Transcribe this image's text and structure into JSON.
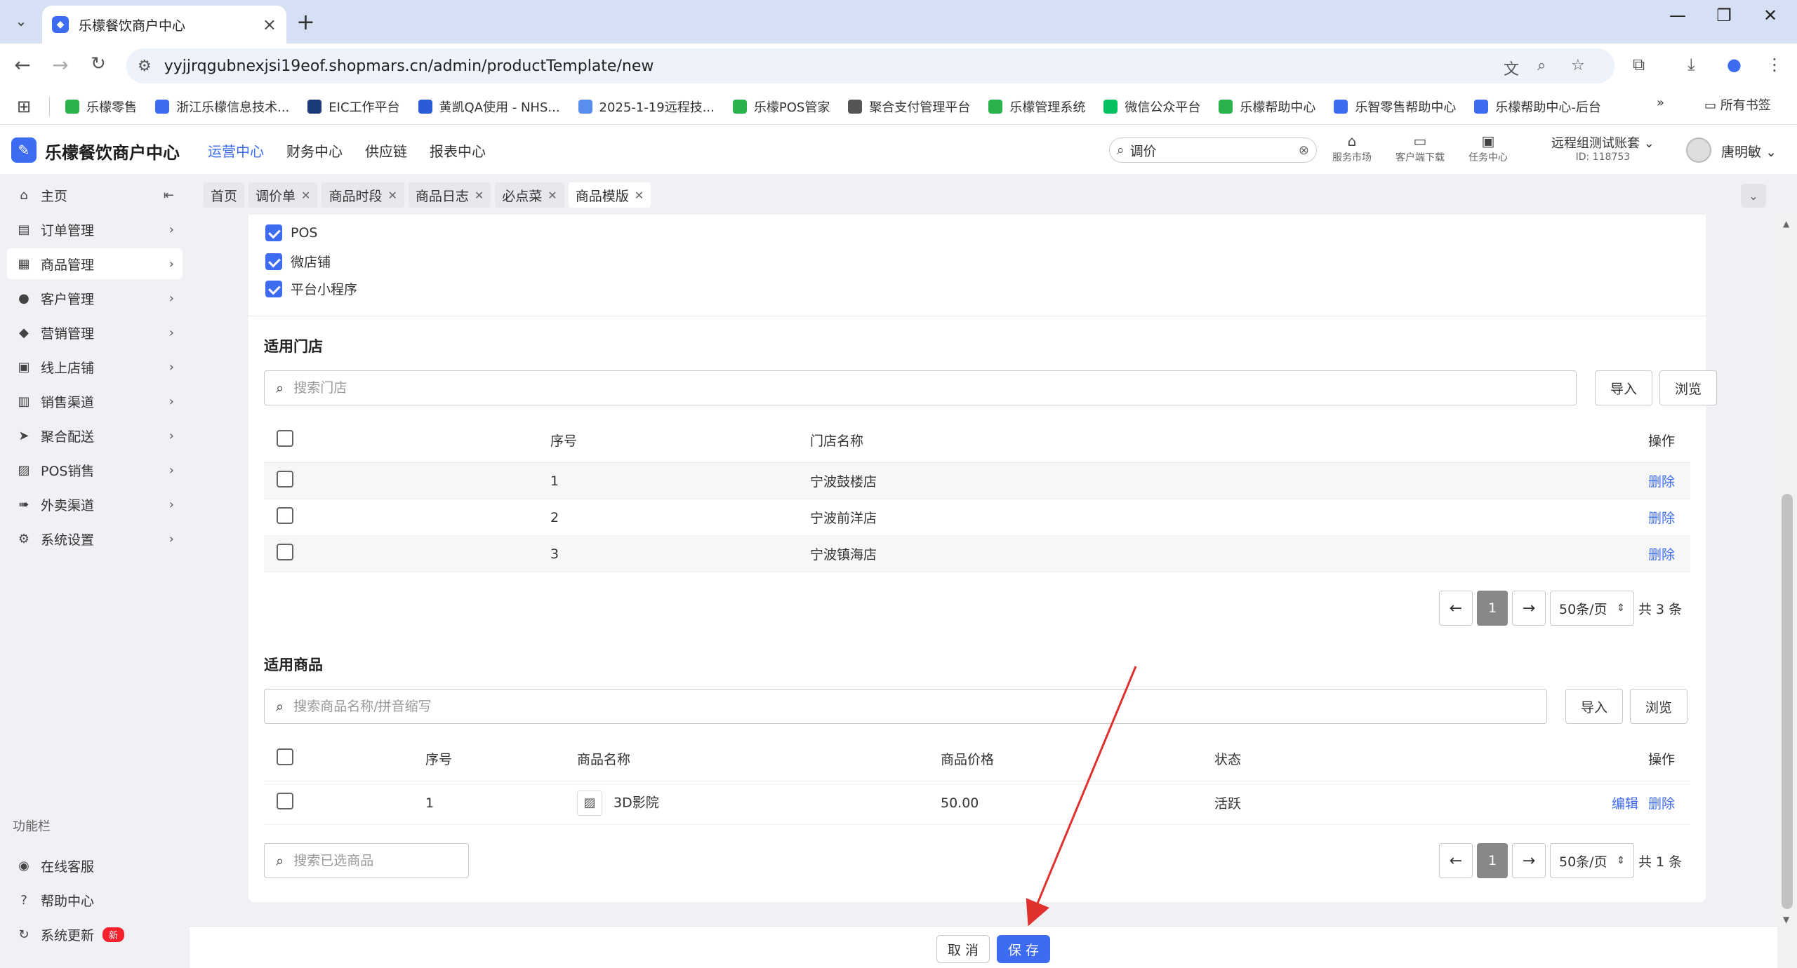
{
  "browser": {
    "tab_title": "乐檬餐饮商户中心",
    "url": "yyjjrqgubnexjsi19eof.shopmars.cn/admin/productTemplate/new",
    "bookmarks": [
      {
        "label": "乐檬零售",
        "color": "#2bb24c"
      },
      {
        "label": "浙江乐檬信息技术...",
        "color": "#3d6bf2"
      },
      {
        "label": "EIC工作平台",
        "color": "#1a3a7a"
      },
      {
        "label": "黄凯QA使用 - NHS...",
        "color": "#2a5bd7"
      },
      {
        "label": "2025-1-19远程技...",
        "color": "#5b8def"
      },
      {
        "label": "乐檬POS管家",
        "color": "#2bb24c"
      },
      {
        "label": "聚合支付管理平台",
        "color": "#555555"
      },
      {
        "label": "乐檬管理系统",
        "color": "#2bb24c"
      },
      {
        "label": "微信公众平台",
        "color": "#07c160"
      },
      {
        "label": "乐檬帮助中心",
        "color": "#2bb24c"
      },
      {
        "label": "乐智零售帮助中心",
        "color": "#3d6bf2"
      },
      {
        "label": "乐檬帮助中心-后台",
        "color": "#3d6bf2"
      }
    ],
    "all_bookmarks": "所有书签"
  },
  "header": {
    "logo_text": "乐檬餐饮商户中心",
    "nav": [
      "运营中心",
      "财务中心",
      "供应链",
      "报表中心"
    ],
    "search_value": "调价",
    "tools": [
      "服务市场",
      "客户端下载",
      "任务中心"
    ],
    "account_name": "远程组测试账套",
    "account_id": "ID: 118753",
    "user_name": "唐明敏"
  },
  "sidebar": {
    "items": [
      {
        "label": "主页",
        "icon": "home-icon"
      },
      {
        "label": "订单管理",
        "icon": "order-icon"
      },
      {
        "label": "商品管理",
        "icon": "product-icon"
      },
      {
        "label": "客户管理",
        "icon": "user-icon"
      },
      {
        "label": "营销管理",
        "icon": "tag-icon"
      },
      {
        "label": "线上店铺",
        "icon": "shop-icon"
      },
      {
        "label": "销售渠道",
        "icon": "bank-icon"
      },
      {
        "label": "聚合配送",
        "icon": "delivery-icon"
      },
      {
        "label": "POS销售",
        "icon": "pos-icon"
      },
      {
        "label": "外卖渠道",
        "icon": "takeout-icon"
      },
      {
        "label": "系统设置",
        "icon": "gear-icon"
      }
    ],
    "function_title": "功能栏",
    "function_items": [
      {
        "label": "在线客服"
      },
      {
        "label": "帮助中心"
      },
      {
        "label": "系统更新",
        "badge": "新"
      }
    ]
  },
  "page_tabs": [
    {
      "label": "首页",
      "closable": false
    },
    {
      "label": "调价单",
      "closable": true
    },
    {
      "label": "商品时段",
      "closable": true
    },
    {
      "label": "商品日志",
      "closable": true
    },
    {
      "label": "必点菜",
      "closable": true
    },
    {
      "label": "商品模版",
      "closable": true,
      "active": true
    }
  ],
  "channels": [
    "POS",
    "微店铺",
    "平台小程序"
  ],
  "stores": {
    "title": "适用门店",
    "search_placeholder": "搜索门店",
    "import_label": "导入",
    "browse_label": "浏览",
    "columns": {
      "index": "序号",
      "name": "门店名称",
      "action": "操作"
    },
    "rows": [
      {
        "index": "1",
        "name": "宁波鼓楼店",
        "action": "删除"
      },
      {
        "index": "2",
        "name": "宁波前洋店",
        "action": "删除"
      },
      {
        "index": "3",
        "name": "宁波镇海店",
        "action": "删除"
      }
    ],
    "pager": {
      "page": "1",
      "size": "50条/页",
      "total": "共 3 条"
    }
  },
  "products": {
    "title": "适用商品",
    "search_placeholder": "搜索商品名称/拼音缩写",
    "import_label": "导入",
    "browse_label": "浏览",
    "columns": {
      "index": "序号",
      "name": "商品名称",
      "price": "商品价格",
      "status": "状态",
      "action": "操作"
    },
    "rows": [
      {
        "index": "1",
        "name": "3D影院",
        "price": "50.00",
        "status": "活跃",
        "edit": "编辑",
        "delete": "删除"
      }
    ],
    "selected_search_placeholder": "搜索已选商品",
    "pager": {
      "page": "1",
      "size": "50条/页",
      "total": "共 1 条"
    }
  },
  "footer": {
    "cancel": "取 消",
    "save": "保 存"
  },
  "colors": {
    "accent": "#3d6bf2",
    "annotation_arrow": "#e0312f"
  }
}
